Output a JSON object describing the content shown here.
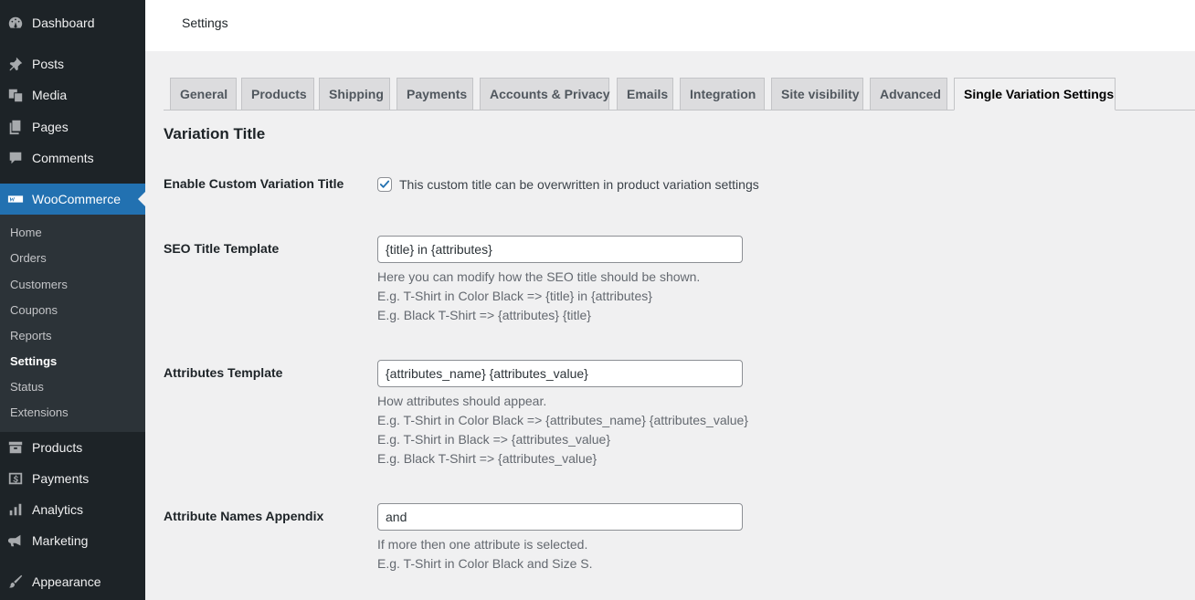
{
  "sidebar": {
    "top_items": [
      {
        "label": "Dashboard",
        "icon": "dashboard-icon"
      },
      {
        "label": "Posts",
        "icon": "pin-icon"
      },
      {
        "label": "Media",
        "icon": "media-icon"
      },
      {
        "label": "Pages",
        "icon": "pages-icon"
      },
      {
        "label": "Comments",
        "icon": "comments-icon"
      },
      {
        "label": "WooCommerce",
        "icon": "woocommerce-icon"
      }
    ],
    "submenu": [
      "Home",
      "Orders",
      "Customers",
      "Coupons",
      "Reports",
      "Settings",
      "Status",
      "Extensions"
    ],
    "bottom_items": [
      {
        "label": "Products",
        "icon": "archive-icon"
      },
      {
        "label": "Payments",
        "icon": "payments-icon"
      },
      {
        "label": "Analytics",
        "icon": "analytics-icon"
      },
      {
        "label": "Marketing",
        "icon": "megaphone-icon"
      },
      {
        "label": "Appearance",
        "icon": "brush-icon"
      }
    ],
    "active_color": "#2271b1"
  },
  "header": {
    "title": "Settings"
  },
  "tabs": [
    {
      "label": "General"
    },
    {
      "label": "Products"
    },
    {
      "label": "Shipping"
    },
    {
      "label": "Payments"
    },
    {
      "label": "Accounts & Privacy"
    },
    {
      "label": "Emails"
    },
    {
      "label": "Integration"
    },
    {
      "label": "Site visibility"
    },
    {
      "label": "Advanced"
    },
    {
      "label": "Single Variation Settings",
      "active": true
    }
  ],
  "section": {
    "title": "Variation Title",
    "enable": {
      "label": "Enable Custom Variation Title",
      "checked": true,
      "checkbox_label": "This custom title can be overwritten in product variation settings"
    },
    "seo": {
      "label": "SEO Title Template",
      "value": "{title} in {attributes}",
      "desc": [
        "Here you can modify how the SEO title should be shown.",
        "E.g. T-Shirt in Color Black => {title} in {attributes}",
        "E.g. Black T-Shirt => {attributes} {title}"
      ]
    },
    "attributes": {
      "label": "Attributes Template",
      "value": "{attributes_name} {attributes_value}",
      "desc": [
        "How attributes should appear.",
        "E.g. T-Shirt in Color Black => {attributes_name} {attributes_value}",
        "E.g. T-Shirt in Black => {attributes_value}",
        "E.g. Black T-Shirt => {attributes_value}"
      ]
    },
    "appendix": {
      "label": "Attribute Names Appendix",
      "value": "and",
      "desc": [
        "If more then one attribute is selected.",
        "E.g. T-Shirt in Color Black and Size S."
      ]
    }
  }
}
